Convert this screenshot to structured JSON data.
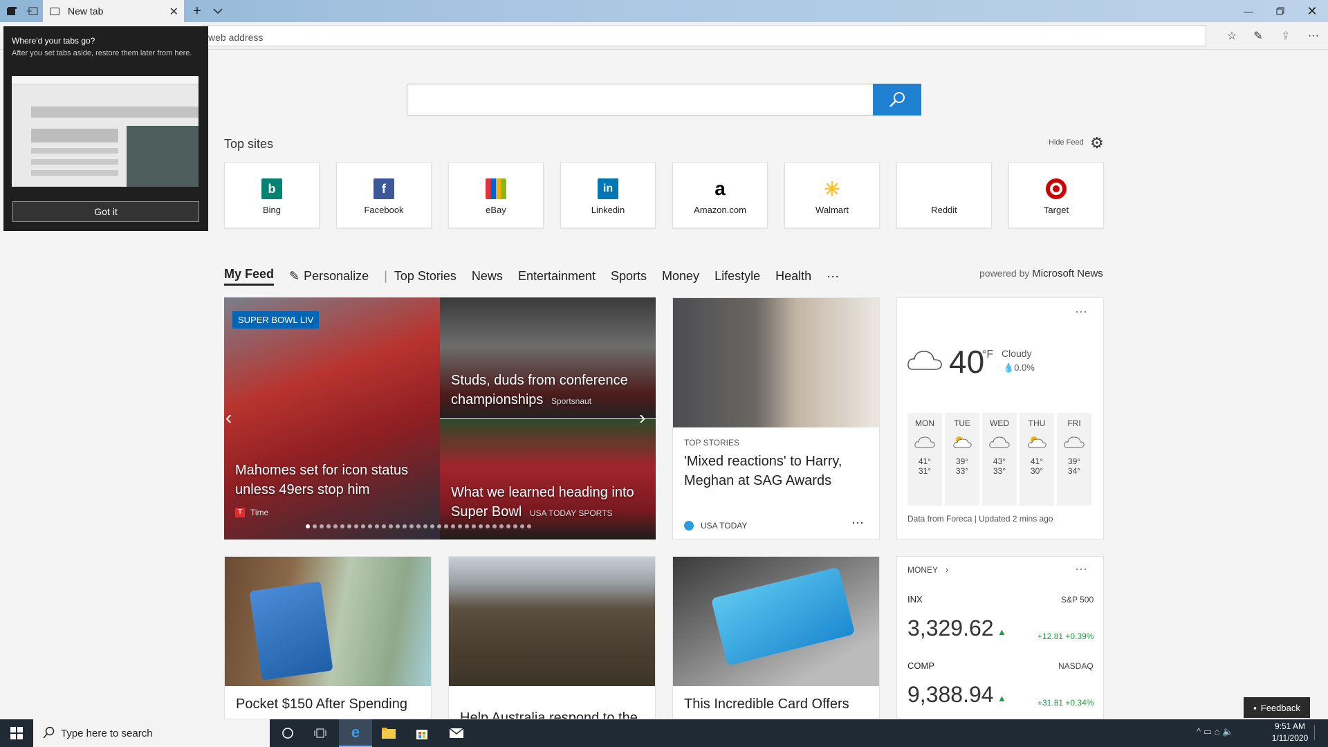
{
  "browser": {
    "tab_title": "New tab",
    "address_placeholder": "web address"
  },
  "popup": {
    "title": "Where'd your tabs go?",
    "body": "After you set tabs aside, restore them later from here.",
    "button": "Got it"
  },
  "top_sites": {
    "label": "Top sites",
    "hide_feed": "Hide Feed",
    "sites": [
      {
        "name": "Bing",
        "color": "#008373"
      },
      {
        "name": "Facebook",
        "color": "#3b5998"
      },
      {
        "name": "eBay",
        "color": "#0064d2"
      },
      {
        "name": "Linkedin",
        "color": "#0077b5"
      },
      {
        "name": "Amazon.com",
        "color": "#000000"
      },
      {
        "name": "Walmart",
        "color": "#ffc220"
      },
      {
        "name": "Reddit",
        "color": "#ff4500"
      },
      {
        "name": "Target",
        "color": "#cc0000"
      }
    ]
  },
  "feed_nav": {
    "items": [
      "My Feed",
      "Personalize",
      "Top Stories",
      "News",
      "Entertainment",
      "Sports",
      "Money",
      "Lifestyle",
      "Health",
      "···"
    ],
    "powered_by": "powered by",
    "powered_brand": "Microsoft News"
  },
  "hero": {
    "badge": "SUPER BOWL LIV",
    "main_title": "Mahomes set for icon status unless 49ers stop him",
    "main_source": "Time",
    "top_title": "Studs, duds from conference championships",
    "top_source": "Sportsnaut",
    "bottom_title": "What we learned heading into Super Bowl",
    "bottom_source": "USA TODAY SPORTS"
  },
  "story": {
    "category": "TOP STORIES",
    "title": "'Mixed reactions' to Harry, Meghan at SAG Awards",
    "source": "USA TODAY",
    "more": "···"
  },
  "weather": {
    "more": "···",
    "temp": "40",
    "unit": "°F",
    "condition": "Cloudy",
    "precip": "0.0%",
    "days": [
      {
        "day": "MON",
        "hi": "41°",
        "lo": "31°",
        "icon": "cloud-icon"
      },
      {
        "day": "TUE",
        "hi": "39°",
        "lo": "33°",
        "icon": "partly-sunny-icon"
      },
      {
        "day": "WED",
        "hi": "43°",
        "lo": "33°",
        "icon": "cloud-icon"
      },
      {
        "day": "THU",
        "hi": "41°",
        "lo": "30°",
        "icon": "partly-sunny-icon"
      },
      {
        "day": "FRI",
        "hi": "39°",
        "lo": "34°",
        "icon": "cloud-icon"
      }
    ],
    "footer": "Data from Foreca | Updated 2 mins ago"
  },
  "row2": {
    "card1_title": "Pocket $150 After Spending",
    "card2_title": "Help Australia respond to the",
    "card3_title": "This Incredible Card Offers"
  },
  "money": {
    "label": "MONEY",
    "more": "···",
    "stocks": [
      {
        "symbol": "INX",
        "name": "S&P 500",
        "value": "3,329.62",
        "change": "+12.81",
        "pct": "+0.39%"
      },
      {
        "symbol": "COMP",
        "name": "NASDAQ",
        "value": "9,388.94",
        "change": "+31.81",
        "pct": "+0.34%"
      }
    ]
  },
  "feedback": "Feedback",
  "taskbar": {
    "search_placeholder": "Type here to search",
    "time": "9:51 AM",
    "date": "1/11/2020"
  },
  "colors": {
    "accent": "#1f7fd1",
    "up": "#1e9e3a",
    "badge": "#0067b8"
  }
}
